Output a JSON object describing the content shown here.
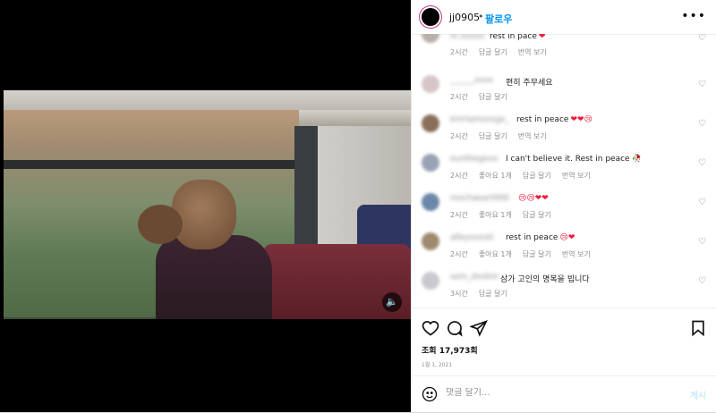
{
  "header": {
    "username": "jj0905",
    "separator": "•",
    "follow_label": "팔로우",
    "more_icon": "more-horizontal-icon"
  },
  "comments": [
    {
      "user": "m.xxxxx",
      "text": "rest in pace",
      "emoji": "❤",
      "meta": [
        "2시간",
        "답글 달기",
        "번역 보기"
      ],
      "avatar_color": "#b8b0a8"
    },
    {
      "user": "______xxxx",
      "text": "편히 주무세요",
      "emoji": "",
      "meta": [
        "2시간",
        "답글 달기"
      ],
      "avatar_color": "#d6c6c8"
    },
    {
      "user": "kmrlamxxxgx_",
      "text": "rest in peace",
      "emoji": "❤❤😢",
      "meta": [
        "2시간",
        "답글 달기",
        "번역 보기"
      ],
      "avatar_color": "#8a6f5a"
    },
    {
      "user": "eunthegxxx",
      "text": "I can't believe it. Rest in peace",
      "emoji": "🥀",
      "meta": [
        "2시간",
        "좋아요 1개",
        "답글 달기",
        "번역 보기"
      ],
      "avatar_color": "#9aa3b5"
    },
    {
      "user": "mochaeart000",
      "text": "",
      "emoji": "😢😢❤❤",
      "meta": [
        "2시간",
        "좋아요 1개",
        "답글 달기"
      ],
      "avatar_color": "#6b87a8"
    },
    {
      "user": "alleyxxxx0",
      "text": "rest in peace",
      "emoji": "😢❤",
      "meta": [
        "2시간",
        "좋아요 1개",
        "답글 달기",
        "번역 보기"
      ],
      "avatar_color": "#a08a6f"
    },
    {
      "user": "sem_dxxkm",
      "text": "삼가 고인의 명복을 빕니다",
      "emoji": "",
      "meta": [
        "3시간",
        "답글 달기"
      ],
      "avatar_color": "#c9c9cf"
    }
  ],
  "actions": {
    "views": "조회 17,973회",
    "date": "1월 1, 2021"
  },
  "compose": {
    "placeholder": "댓글 달기...",
    "post_label": "게시"
  },
  "colors": {
    "accent": "#0095f6",
    "heart": "#ed1c3a",
    "ring": "#c13584"
  }
}
